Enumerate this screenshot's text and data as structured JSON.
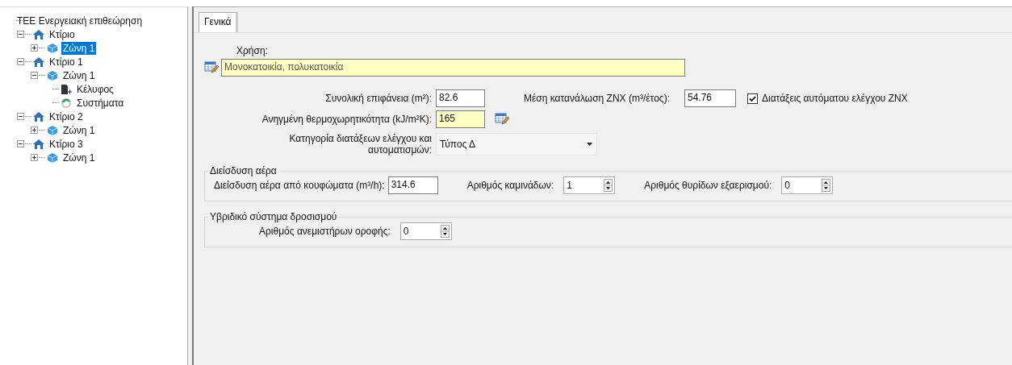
{
  "tree": [
    {
      "kind": "root",
      "label": "ΤΕΕ Ενεργειακή επιθεώρηση",
      "selected": false,
      "children": [
        {
          "kind": "building",
          "label": "Κτίριο",
          "expanded": true,
          "selected": false,
          "children": [
            {
              "kind": "zone",
              "label": "Ζώνη 1",
              "expanded": false,
              "selected": true
            }
          ]
        },
        {
          "kind": "building",
          "label": "Κτίριο 1",
          "expanded": true,
          "selected": false,
          "children": [
            {
              "kind": "zone",
              "label": "Ζώνη 1",
              "expanded": true,
              "selected": false,
              "children": [
                {
                  "kind": "shell",
                  "label": "Κέλυφος",
                  "selected": false
                },
                {
                  "kind": "systems",
                  "label": "Συστήματα",
                  "selected": false
                }
              ]
            }
          ]
        },
        {
          "kind": "building",
          "label": "Κτίριο 2",
          "expanded": true,
          "selected": false,
          "children": [
            {
              "kind": "zone",
              "label": "Ζώνη 1",
              "expanded": false,
              "selected": false
            }
          ]
        },
        {
          "kind": "building",
          "label": "Κτίριο 3",
          "expanded": true,
          "selected": false,
          "children": [
            {
              "kind": "zone",
              "label": "Ζώνη 1",
              "expanded": false,
              "selected": false
            }
          ]
        }
      ]
    }
  ],
  "tabs": [
    {
      "label": "Γενικά",
      "selected": true
    }
  ],
  "usage": {
    "label": "Χρήση:",
    "value": "Μονοκατοικία, πολυκατοικία"
  },
  "area": {
    "label": "Συνολική επιφάνεια (m²):",
    "value": "82.6"
  },
  "dhw": {
    "label": "Μέση κατανάλωση ZNX (m³/έτος):",
    "value": "54.76"
  },
  "dhw_control": {
    "label": "Διατάξεις αυτόματου ελέγχου ZNX",
    "checked": true
  },
  "heat_capacity": {
    "label": "Ανηγμένη θερμοχωρητικότητα (kJ/m²K):",
    "value": "165"
  },
  "control_category": {
    "label": "Κατηγορία διατάξεων ελέγχου και αυτοματισμών:",
    "value": "Τύπος Δ"
  },
  "groups": [
    {
      "title": "Διείσδυση αέρα",
      "fields": [
        {
          "kind": "text",
          "label": "Διείσδυση αέρα από κουφώματα (m³/h):",
          "value": "314.6"
        },
        {
          "kind": "spinner",
          "label": "Αριθμός καμινάδων:",
          "value": "1"
        },
        {
          "kind": "spinner",
          "label": "Αριθμός θυρίδων εξαερισμού:",
          "value": "0"
        }
      ]
    },
    {
      "title": "Υβριδικό σύστημα δροσισμού",
      "fields": [
        {
          "kind": "spinner",
          "label": "Αριθμός ανεμιστήρων οροφής:",
          "value": "0"
        }
      ]
    }
  ]
}
